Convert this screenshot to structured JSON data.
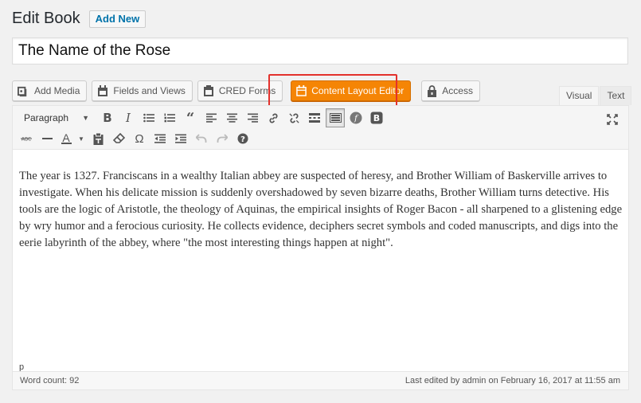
{
  "page": {
    "title": "Edit Book",
    "add_new_label": "Add New"
  },
  "post": {
    "title": "The Name of the Rose"
  },
  "media_buttons": [
    {
      "label": "Add Media",
      "icon": "add-media-icon"
    },
    {
      "label": "Fields and Views",
      "icon": "calendar-icon"
    },
    {
      "label": "CRED Forms",
      "icon": "form-icon"
    },
    {
      "label": "Content Layout Editor",
      "icon": "layout-icon"
    },
    {
      "label": "Access",
      "icon": "lock-icon"
    }
  ],
  "editor_tabs": {
    "visual": "Visual",
    "text": "Text"
  },
  "toolbar": {
    "format_select": "Paragraph",
    "row1_icons": [
      "bold-icon",
      "italic-icon",
      "bullet-list-icon",
      "numbered-list-icon",
      "blockquote-icon",
      "align-left-icon",
      "align-center-icon",
      "align-right-icon",
      "link-icon",
      "unlink-icon",
      "read-more-icon",
      "toolbar-toggle-icon",
      "views-icon",
      "bootstrap-icon"
    ],
    "row2_icons": [
      "strikethrough-icon",
      "horizontal-line-icon",
      "text-color-icon",
      "paste-text-icon",
      "clear-formatting-icon",
      "special-character-icon",
      "outdent-icon",
      "indent-icon",
      "undo-icon",
      "redo-icon",
      "help-icon"
    ],
    "fullscreen_icon": "fullscreen-icon",
    "accent": "#f58505",
    "highlight": "#e3312c"
  },
  "content": {
    "body": "The year is 1327. Franciscans in a wealthy Italian abbey are suspected of heresy, and Brother William of Baskerville arrives to investigate. When his delicate mission is suddenly overshadowed by seven bizarre deaths, Brother William turns detective. His tools are the logic of Aristotle, the theology of Aquinas, the empirical insights of Roger Bacon - all sharpened to a glistening edge by wry humor and a ferocious curiosity. He collects evidence, deciphers secret symbols and coded manuscripts, and digs into the eerie labyrinth of the abbey, where \"the most interesting things happen at night\"."
  },
  "status": {
    "path": "p",
    "word_count": "Word count: 92",
    "last_edited": "Last edited by admin on February 16, 2017 at 11:55 am"
  }
}
